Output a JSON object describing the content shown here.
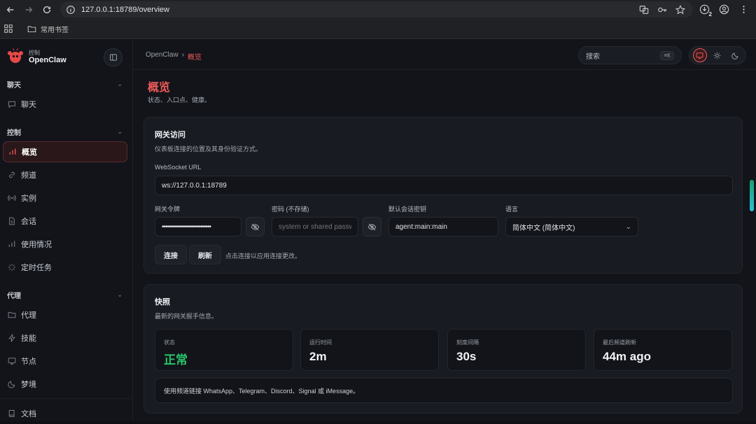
{
  "browser": {
    "url": "127.0.0.1:18789/overview",
    "bookmark_folder": "常用书签",
    "download_count": "2"
  },
  "brand": {
    "sub": "控制",
    "name": "OpenClaw"
  },
  "sidebar": {
    "sections": [
      {
        "title": "聊天",
        "items": [
          {
            "label": "聊天",
            "icon": "chat-icon"
          }
        ]
      },
      {
        "title": "控制",
        "items": [
          {
            "label": "概览",
            "icon": "bar-chart-icon",
            "active": true
          },
          {
            "label": "频道",
            "icon": "link-icon"
          },
          {
            "label": "实例",
            "icon": "radio-icon"
          },
          {
            "label": "会话",
            "icon": "file-icon"
          },
          {
            "label": "使用情况",
            "icon": "bar-chart-icon"
          },
          {
            "label": "定时任务",
            "icon": "loader-icon"
          }
        ]
      },
      {
        "title": "代理",
        "items": [
          {
            "label": "代理",
            "icon": "folder-icon"
          },
          {
            "label": "技能",
            "icon": "bolt-icon"
          },
          {
            "label": "节点",
            "icon": "monitor-icon"
          },
          {
            "label": "梦境",
            "icon": "moon-icon"
          }
        ]
      }
    ],
    "docs_label": "文档"
  },
  "topbar": {
    "breadcrumb_root": "OpenClaw",
    "breadcrumb_sep": "›",
    "breadcrumb_current": "概览",
    "search_label": "搜索",
    "search_shortcut": "⌘K"
  },
  "page": {
    "title": "概览",
    "subtitle": "状态、入口点、健康。"
  },
  "gateway": {
    "title": "网关访问",
    "subtitle": "仪表板连接的位置及其身份验证方式。",
    "ws_label": "WebSocket URL",
    "ws_value": "ws://127.0.0.1:18789",
    "token_label": "网关令牌",
    "token_value": "••••••••••••••••••••••••••••",
    "password_label": "密码 (不存储)",
    "password_placeholder": "system or shared passw",
    "session_key_label": "默认会话密钥",
    "session_key_value": "agent:main:main",
    "language_label": "语言",
    "language_value": "简体中文 (简体中文)",
    "connect_label": "连接",
    "refresh_label": "刷新",
    "hint": "点击连接以应用连接更改。"
  },
  "snapshot": {
    "title": "快照",
    "subtitle": "最新的网关握手信息。",
    "stats": [
      {
        "label": "状态",
        "value": "正常",
        "ok": true
      },
      {
        "label": "运行时间",
        "value": "2m"
      },
      {
        "label": "刻度间隔",
        "value": "30s"
      },
      {
        "label": "最后频道刷新",
        "value": "44m ago"
      }
    ],
    "note": "使用频道链接 WhatsApp、Telegram、Discord、Signal 或 iMessage。"
  },
  "colors": {
    "accent": "#ef5a5a",
    "ok": "#27c46a"
  }
}
